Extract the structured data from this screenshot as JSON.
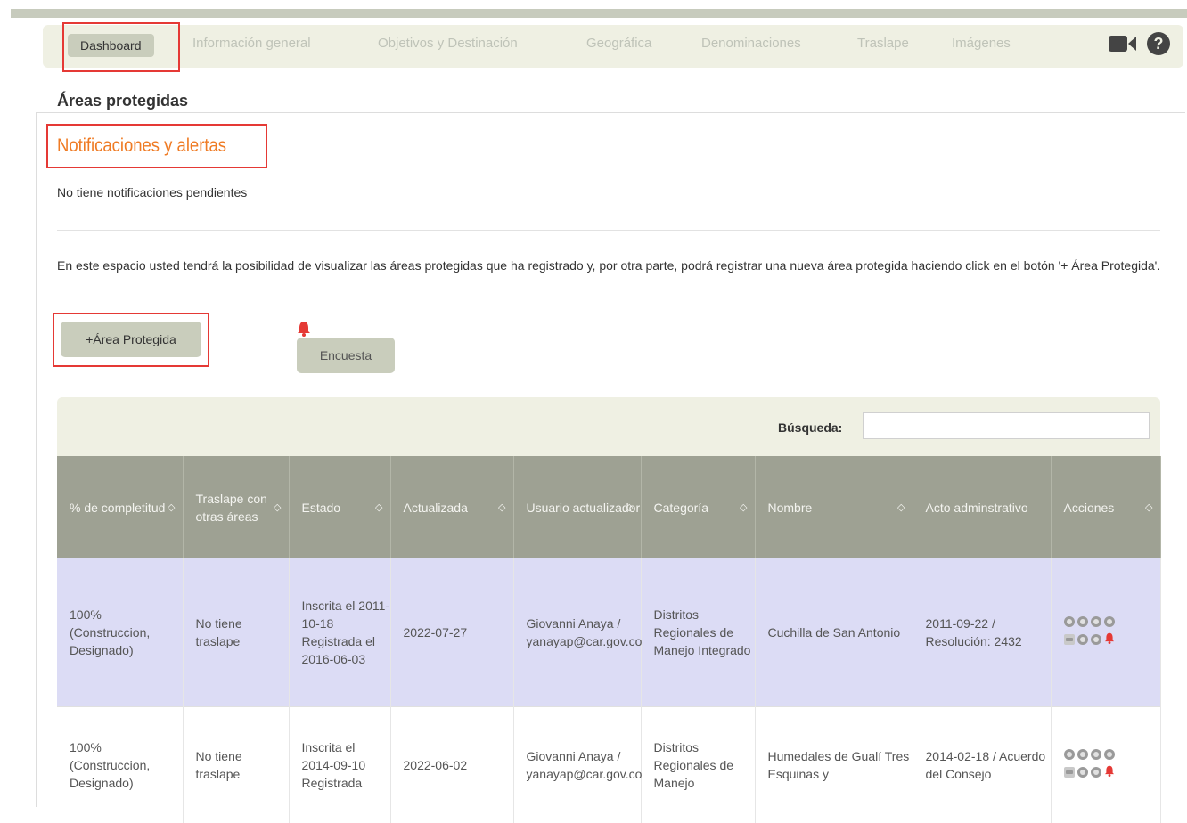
{
  "nav": {
    "tabs": [
      "Dashboard",
      "Información general",
      "Objetivos y Destinación",
      "Geográfica",
      "Denominaciones",
      "Traslape",
      "Imágenes"
    ],
    "icons": [
      "video-camera-icon",
      "help-icon"
    ]
  },
  "panel": {
    "title": "Áreas protegidas",
    "notifications_title": "Notificaciones y alertas",
    "no_notifications": "No tiene notificaciones pendientes",
    "description": "En este espacio usted tendrá la posibilidad de visualizar las áreas protegidas que ha registrado y, por otra parte, podrá registrar una nueva área protegida haciendo click en el botón '+ Área Protegida'.",
    "add_button": "+Área Protegida",
    "survey_button": "Encuesta"
  },
  "table": {
    "search_label": "Búsqueda:",
    "search_value": "",
    "headers": [
      "% de completitud",
      "Traslape con otras áreas",
      "Estado",
      "Actualizada",
      "Usuario actualizador",
      "Categoría",
      "Nombre",
      "Acto adminstrativo",
      "Acciones"
    ],
    "rows": [
      {
        "completitud": "100% (Construccion, Designado)",
        "traslape": "No tiene traslape",
        "estado": "Inscrita el 2011-10-18 Registrada el 2016-06-03",
        "actualizada": "2022-07-27",
        "usuario": "Giovanni Anaya / yanayap@car.gov.co",
        "categoria": "Distritos Regionales de Manejo Integrado",
        "nombre": "Cuchilla de San Antonio",
        "acto": "2011-09-22 / Resolución: 2432"
      },
      {
        "completitud": "100% (Construccion, Designado)",
        "traslape": "No tiene traslape",
        "estado": "Inscrita el 2014-09-10 Registrada",
        "actualizada": "2022-06-02",
        "usuario": "Giovanni Anaya / yanayap@car.gov.co",
        "categoria": "Distritos Regionales de Manejo",
        "nombre": "Humedales de Gualí Tres Esquinas y",
        "acto": "2014-02-18 / Acuerdo del Consejo"
      }
    ]
  },
  "colors": {
    "accent_orange": "#ef7b24",
    "alert_red": "#e53935",
    "header_bg": "#9ea193",
    "row_highlight": "#dcdcf5",
    "button_bg": "#c9cdbc"
  }
}
